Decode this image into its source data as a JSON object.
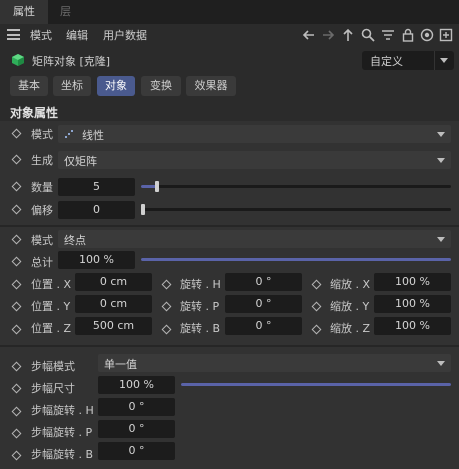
{
  "tabs": {
    "active": "属性",
    "inactive": "层"
  },
  "menu": {
    "mode": "模式",
    "edit": "编辑",
    "user_data": "用户数据"
  },
  "toolbar_icons": [
    "arrow-left-icon",
    "arrow-right-icon",
    "arrow-up-icon",
    "search-icon",
    "filter-icon",
    "lock-icon",
    "target-icon",
    "new-window-icon"
  ],
  "object": {
    "name": "矩阵对象 [克隆]",
    "preset": "自定义"
  },
  "prop_tabs": [
    "基本",
    "坐标",
    "对象",
    "变换",
    "效果器"
  ],
  "active_tab": "对象",
  "section_title": "对象属性",
  "params": {
    "mode_label": "模式",
    "mode_value": "线性",
    "generate_label": "生成",
    "generate_value": "仅矩阵",
    "count_label": "数量",
    "count_value": "5",
    "count_fraction": 0.05,
    "offset_label": "偏移",
    "offset_value": "0",
    "offset_fraction": 0.0,
    "mode2_label": "模式",
    "mode2_value": "终点",
    "total_label": "总计",
    "total_value": "100 %",
    "total_fraction": 1.0,
    "pos_x_label": "位置 . X",
    "pos_x_value": "0 cm",
    "pos_y_label": "位置 . Y",
    "pos_y_value": "0 cm",
    "pos_z_label": "位置 . Z",
    "pos_z_value": "500 cm",
    "rot_h_label": "旋转 . H",
    "rot_h_value": "0 °",
    "rot_p_label": "旋转 . P",
    "rot_p_value": "0 °",
    "rot_b_label": "旋转 . B",
    "rot_b_value": "0 °",
    "scale_x_label": "缩放 . X",
    "scale_x_value": "100 %",
    "scale_y_label": "缩放 . Y",
    "scale_y_value": "100 %",
    "scale_z_label": "缩放 . Z",
    "scale_z_value": "100 %",
    "step_mode_label": "步幅模式",
    "step_mode_value": "单一值",
    "step_size_label": "步幅尺寸",
    "step_size_value": "100 %",
    "step_size_fraction": 1.0,
    "step_rot_h_label": "步幅旋转 . H",
    "step_rot_h_value": "0 °",
    "step_rot_p_label": "步幅旋转 . P",
    "step_rot_p_value": "0 °",
    "step_rot_b_label": "步幅旋转 . B",
    "step_rot_b_value": "0 °"
  },
  "colors": {
    "accent": "#5a63a8",
    "active_tab": "#4a5a8e",
    "background": "#2b2b2b",
    "field": "#1c1c1c"
  }
}
